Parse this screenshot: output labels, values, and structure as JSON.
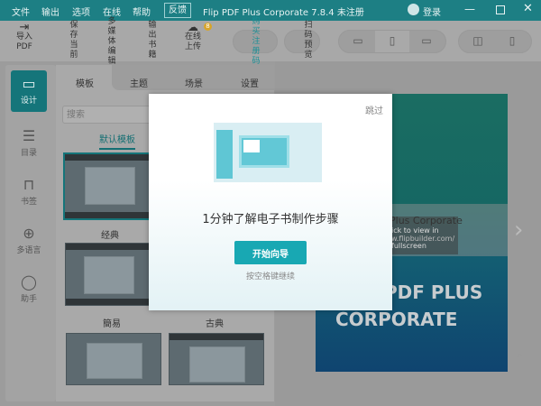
{
  "titlebar": {
    "menus": [
      "文件",
      "输出",
      "选项",
      "在线",
      "帮助"
    ],
    "feedback": "反馈",
    "title": "Flip PDF Plus Corporate 7.8.4 未注册",
    "login": "登录"
  },
  "toolbar": {
    "import": "导入",
    "import2": "PDF",
    "save": "保存当前",
    "media": "多媒体编辑器",
    "export": "输出书籍",
    "upload": "在线",
    "upload2": "上传",
    "badge": "8",
    "buy": "购买注册码",
    "scan": "扫码预览"
  },
  "sidebar": {
    "items": [
      {
        "label": "设计",
        "icon": "monitor-icon"
      },
      {
        "label": "目录",
        "icon": "list-icon"
      },
      {
        "label": "书签",
        "icon": "bookmark-icon"
      },
      {
        "label": "多语言",
        "icon": "globe-icon"
      },
      {
        "label": "助手",
        "icon": "chat-icon"
      }
    ]
  },
  "panel": {
    "tabs": [
      "模板",
      "主题",
      "场景",
      "设置"
    ],
    "search_placeholder": "搜索",
    "subtab": "默认模板",
    "templates": [
      "经典",
      "簡易",
      "古典"
    ]
  },
  "preview": {
    "title_line": "Plus Corporate",
    "hint1": "ick to view in",
    "hint2": "w.flipbuilder.com/",
    "hint3": "fullscreen",
    "cover1": "PDF PLUS",
    "cover2": "CORPORATE"
  },
  "modal": {
    "skip": "跳过",
    "heading": "1分钟了解电子书制作步骤",
    "start": "开始向导",
    "hint": "按空格键继续"
  },
  "colors": {
    "accent": "#18a8b3",
    "titlebar": "#1d7f84"
  }
}
